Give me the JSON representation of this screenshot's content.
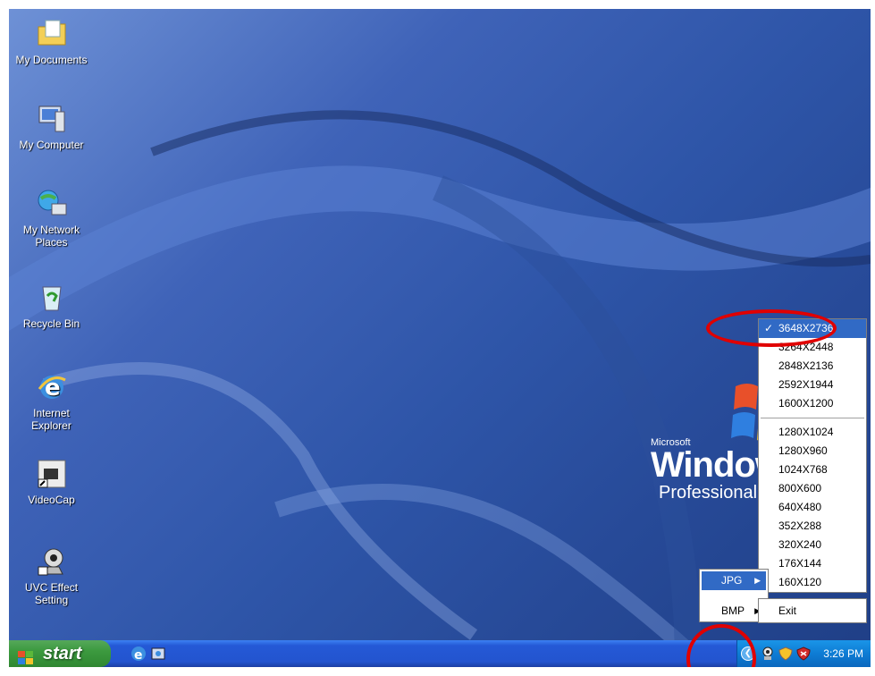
{
  "desktop": {
    "icons": [
      {
        "label_line1": "My Documents",
        "label_line2": "",
        "icon": "my-documents-icon"
      },
      {
        "label_line1": "My Computer",
        "label_line2": "",
        "icon": "my-computer-icon"
      },
      {
        "label_line1": "My Network",
        "label_line2": "Places",
        "icon": "network-places-icon"
      },
      {
        "label_line1": "Recycle Bin",
        "label_line2": "",
        "icon": "recycle-bin-icon"
      },
      {
        "label_line1": "Internet",
        "label_line2": "Explorer",
        "icon": "internet-explorer-icon"
      },
      {
        "label_line1": "VideoCap",
        "label_line2": "",
        "icon": "videocap-icon"
      },
      {
        "label_line1": "UVC Effect",
        "label_line2": "Setting",
        "icon": "webcam-icon"
      }
    ],
    "logo": {
      "brand": "Microsoft",
      "product": "Windows",
      "edition": "Professional"
    }
  },
  "taskbar": {
    "start_label": "start",
    "clock": "3:26 PM"
  },
  "context_menu": {
    "formats": [
      {
        "label": "JPG",
        "has_submenu": true,
        "active": true
      },
      {
        "label": "BMP",
        "has_submenu": true,
        "active": false
      }
    ],
    "exit_label": "Exit",
    "resolutions_group1": [
      "3648X2736",
      "3264X2448",
      "2848X2136",
      "2592X1944",
      "1600X1200"
    ],
    "resolutions_group2": [
      "1280X1024",
      "1280X960",
      "1024X768",
      "800X600",
      "640X480",
      "352X288",
      "320X240",
      "176X144",
      "160X120"
    ],
    "selected_resolution": "3648X2736"
  },
  "colors": {
    "menu_highlight": "#316ac5",
    "annotation_red": "#e00000"
  }
}
